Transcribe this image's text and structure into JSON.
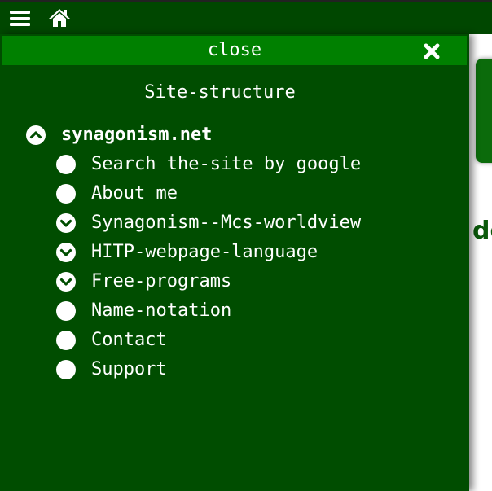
{
  "colors": {
    "topbar": "#004700",
    "panel": "#004d00",
    "close_bar": "#008000",
    "text": "#ffffff"
  },
  "topbar": {
    "menu_icon": "hamburger-menu-icon",
    "home_icon": "home-icon"
  },
  "panel": {
    "close_label": "close",
    "close_icon": "close-x-icon",
    "title": "Site-structure"
  },
  "tree": {
    "root": {
      "label": "synagonism.net",
      "icon": "chevron-up-circle-icon"
    },
    "children": [
      {
        "label": "Search the-site by google",
        "icon": "filled-circle-icon"
      },
      {
        "label": "About me",
        "icon": "filled-circle-icon"
      },
      {
        "label": "Synagonism--Mcs-worldview",
        "icon": "chevron-down-circle-icon"
      },
      {
        "label": "HITP-webpage-language",
        "icon": "chevron-down-circle-icon"
      },
      {
        "label": "Free-programs",
        "icon": "chevron-down-circle-icon"
      },
      {
        "label": "Name-notation",
        "icon": "filled-circle-icon"
      },
      {
        "label": "Contact",
        "icon": "filled-circle-icon"
      },
      {
        "label": "Support",
        "icon": "filled-circle-icon"
      }
    ]
  },
  "background_page": {
    "partial_text": "de"
  }
}
